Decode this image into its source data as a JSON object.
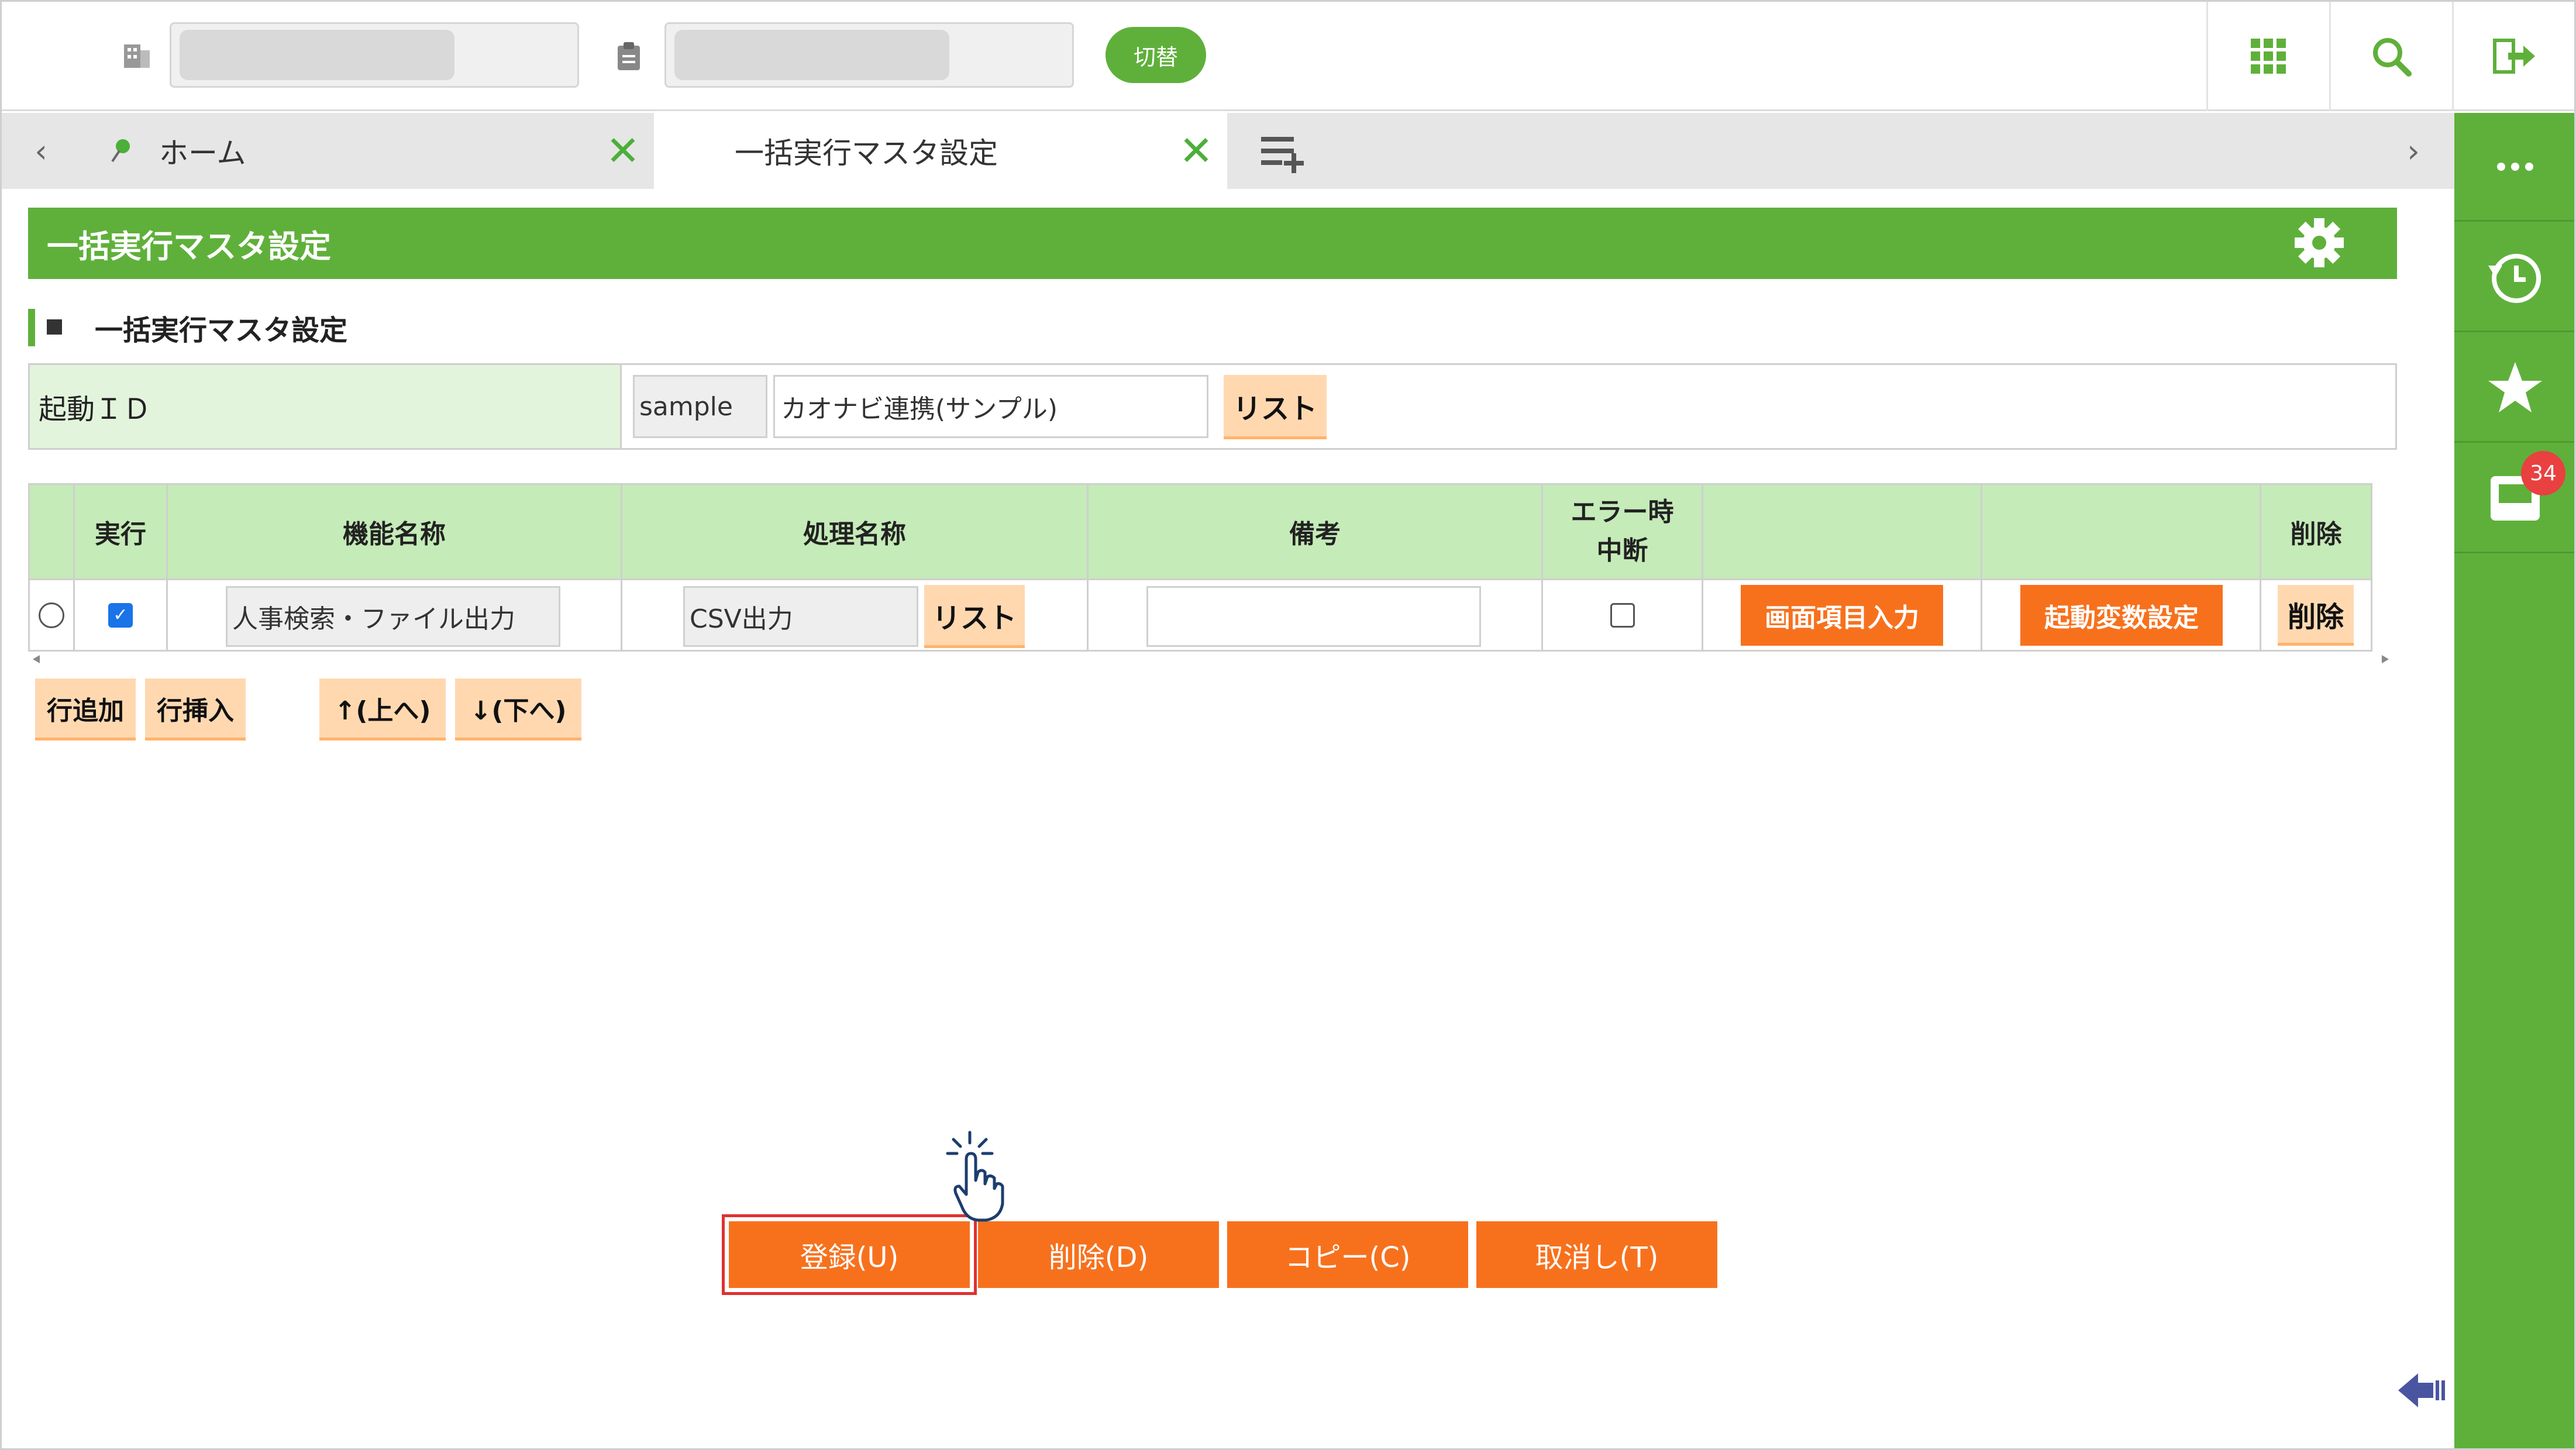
{
  "header": {
    "switch_label": "切替",
    "company_icon": "building-icon",
    "clipboard_icon": "clipboard-icon",
    "menu_icon": "grid-icon",
    "search_icon": "search-icon",
    "logout_icon": "logout-icon"
  },
  "tabs": [
    {
      "label": "ホーム"
    },
    {
      "label": "一括実行マスタ設定"
    }
  ],
  "sidebar": {
    "badge_count": "34"
  },
  "page": {
    "title": "一括実行マスタ設定",
    "section_heading": "一括実行マスタ設定"
  },
  "startup": {
    "label": "起動ＩＤ",
    "id_value": "sample",
    "name_value": "カオナビ連携(サンプル)",
    "list_button": "リスト"
  },
  "table": {
    "headers": [
      "実行",
      "機能名称",
      "処理名称",
      "備考",
      "エラー時",
      "中断",
      "削除"
    ],
    "row": {
      "executed": true,
      "function_name": "人事検索・ファイル出力",
      "process_name": "CSV出力",
      "list_button": "リスト",
      "remarks": "",
      "error_stop": false,
      "screen_input_button": "画面項目入力",
      "startup_var_button": "起動変数設定",
      "delete_button": "削除"
    }
  },
  "row_buttons": {
    "add": "行追加",
    "insert": "行挿入",
    "up": "↑(上へ)",
    "down": "↓(下へ)"
  },
  "actions": {
    "register": "登録(U)",
    "delete": "削除(D)",
    "copy": "コピー(C)",
    "cancel": "取消し(T)"
  },
  "colors": {
    "brand_green": "#5fb03b",
    "accent_orange": "#f7711d",
    "light_button": "#ffd8b0",
    "header_green": "#c5ebb8",
    "highlight_red": "#e03030"
  }
}
